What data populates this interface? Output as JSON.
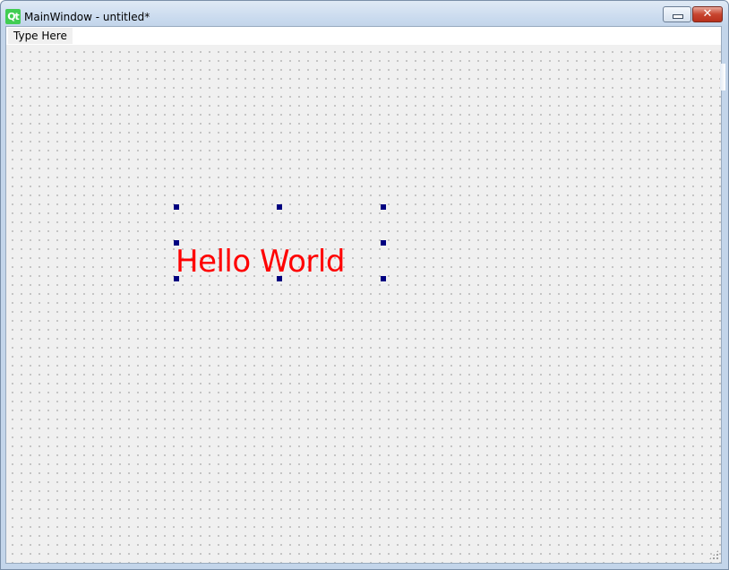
{
  "window": {
    "title": "MainWindow - untitled*",
    "app_icon_text": "Qt",
    "minimize_glyph": "",
    "close_glyph": "✕"
  },
  "menubar": {
    "items": [
      {
        "label": "Type Here"
      }
    ]
  },
  "canvas": {
    "label_text": "Hello World",
    "label_color": "#ff0000",
    "selection_handle_color": "#000080"
  },
  "colors": {
    "qt_brand": "#41cd52",
    "close_button": "#c8452f"
  },
  "icons": {
    "app": "qt-logo-icon",
    "minimize": "minimize-icon",
    "close": "close-icon",
    "size_grip": "size-grip-icon"
  }
}
